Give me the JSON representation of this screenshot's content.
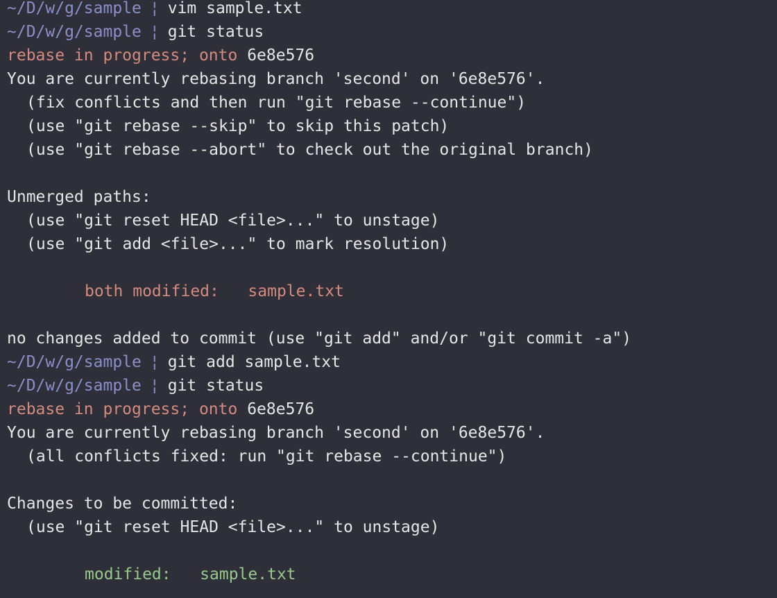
{
  "colors": {
    "background": "#2f2f3a",
    "text": "#e6e6e6",
    "prompt": "#8c8fc9",
    "unmerged_red": "#d48b7e",
    "staged_green": "#96c98a"
  },
  "prompt_path": "~/D/w/g/sample",
  "prompt_separator": "¦",
  "session": {
    "cmd1": "vim sample.txt",
    "cmd2": "git status",
    "status1": {
      "rebase_label": "rebase in progress; onto",
      "rebase_commit": "6e8e576",
      "rebasing_line": "You are currently rebasing branch 'second' on '6e8e576'.",
      "hint1": "(fix conflicts and then run \"git rebase --continue\")",
      "hint2": "(use \"git rebase --skip\" to skip this patch)",
      "hint3": "(use \"git rebase --abort\" to check out the original branch)",
      "unmerged_header": "Unmerged paths:",
      "unmerged_hint1": "(use \"git reset HEAD <file>...\" to unstage)",
      "unmerged_hint2": "(use \"git add <file>...\" to mark resolution)",
      "file_state": "both modified:",
      "file_name": "sample.txt",
      "no_changes": "no changes added to commit (use \"git add\" and/or \"git commit -a\")"
    },
    "cmd3": "git add sample.txt",
    "cmd4": "git status",
    "status2": {
      "rebase_label": "rebase in progress; onto",
      "rebase_commit": "6e8e576",
      "rebasing_line": "You are currently rebasing branch 'second' on '6e8e576'.",
      "hint1": "(all conflicts fixed: run \"git rebase --continue\")",
      "staged_header": "Changes to be committed:",
      "staged_hint1": "(use \"git reset HEAD <file>...\" to unstage)",
      "file_state": "modified:",
      "file_name": "sample.txt"
    }
  }
}
